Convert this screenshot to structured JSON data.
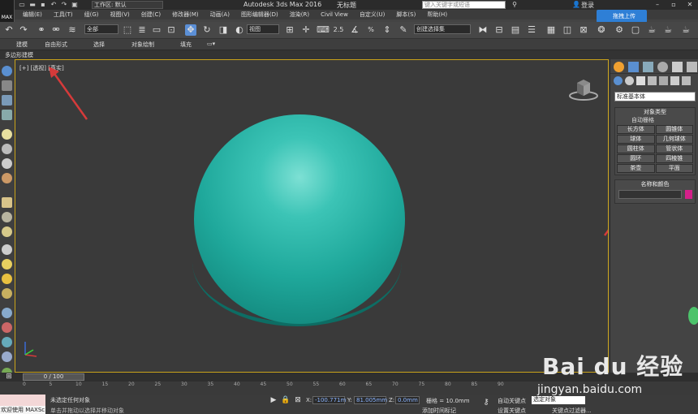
{
  "titlebar": {
    "logo": "MAX",
    "workspace": "工作区: 默认",
    "app_title": "Autodesk 3ds Max 2016",
    "doc_title": "无标题",
    "search_placeholder": "键入关键字或短语",
    "login": "登录"
  },
  "menu": [
    "编辑(E)",
    "工具(T)",
    "组(G)",
    "视图(V)",
    "创建(C)",
    "修改器(M)",
    "动画(A)",
    "图形编辑器(D)",
    "渲染(R)",
    "Civil View",
    "自定义(U)",
    "脚本(S)",
    "帮助(H)"
  ],
  "upload_button": "拖拽上传",
  "toolbar": {
    "filter": "全部",
    "view_select": "视图",
    "named_selection": "创建选择集"
  },
  "ribbon": {
    "tabs": [
      "建模",
      "自由形式",
      "选择",
      "对象绘制",
      "填充"
    ],
    "sub": "多边形建模"
  },
  "viewport": {
    "label": "[+] [透视] [真实]"
  },
  "command_panel": {
    "dropdown": "标准基本体",
    "object_type_title": "对象类型",
    "autogrid": "自动栅格",
    "objects": [
      "长方体",
      "圆锥体",
      "球体",
      "几何球体",
      "圆柱体",
      "管状体",
      "圆环",
      "四棱锥",
      "茶壶",
      "平面"
    ],
    "name_color_title": "名称和颜色"
  },
  "timeline": {
    "slider": "0 / 100",
    "ticks": [
      "0",
      "5",
      "10",
      "15",
      "20",
      "25",
      "30",
      "35",
      "40",
      "45",
      "50",
      "55",
      "60",
      "65",
      "70",
      "75",
      "80",
      "85",
      "90"
    ]
  },
  "status": {
    "maxscript": "欢迎使用 MAXSc",
    "selection": "未选定任何对象",
    "hint": "单击并拖动以选择并移动对象",
    "x_label": "X:",
    "x_value": "-100.771m",
    "y_label": "Y:",
    "y_value": "81.005mm",
    "z_label": "Z:",
    "z_value": "0.0mm",
    "grid": "栅格 = 10.0mm",
    "autokey": "自动关键点",
    "setkey": "设置关键点",
    "selected": "选定对象",
    "addkey": "添加时间标记",
    "keyfilter": "关键点过滤器..."
  },
  "watermark": {
    "brand": "Bai du 经验",
    "url": "jingyan.baidu.com"
  },
  "colors": {
    "sphere": "#1fa89b",
    "viewport_border": "#c9a21a",
    "upload": "#2e7fd6",
    "arrow": "#d63a3a"
  }
}
